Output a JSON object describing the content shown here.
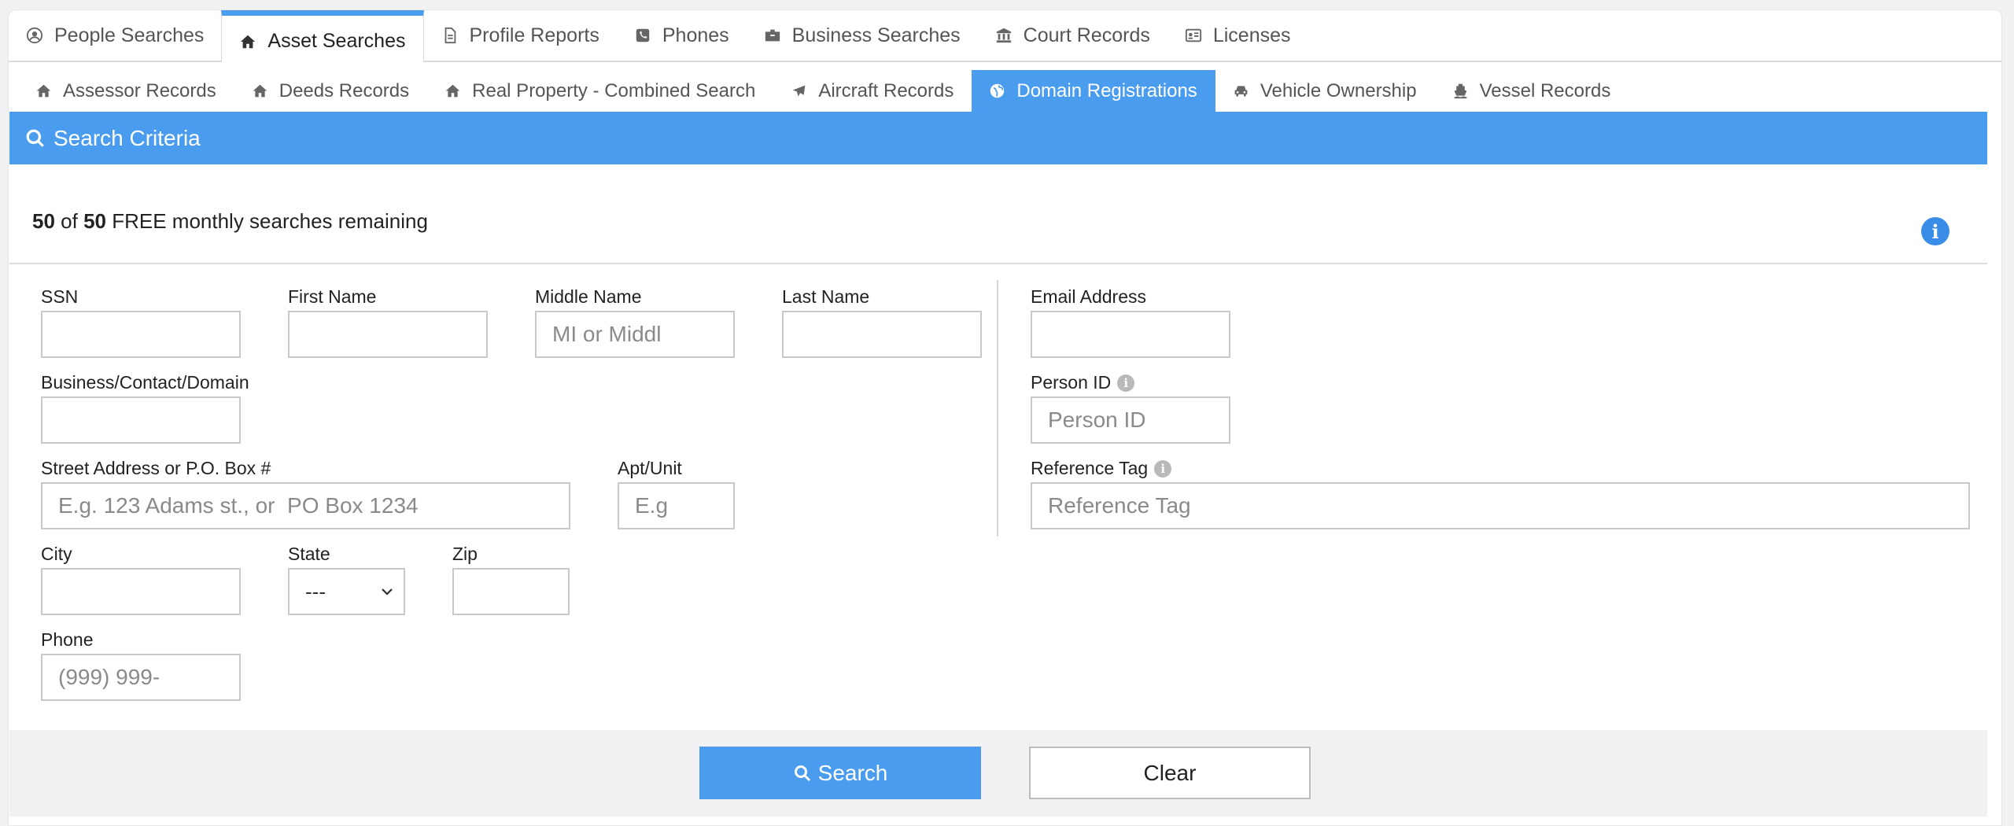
{
  "top_tabs": [
    {
      "label": "People Searches",
      "icon": "user-circle-icon"
    },
    {
      "label": "Asset Searches",
      "icon": "home-icon",
      "active": true
    },
    {
      "label": "Profile Reports",
      "icon": "document-icon"
    },
    {
      "label": "Phones",
      "icon": "phone-icon"
    },
    {
      "label": "Business Searches",
      "icon": "briefcase-icon"
    },
    {
      "label": "Court Records",
      "icon": "courthouse-icon"
    },
    {
      "label": "Licenses",
      "icon": "id-card-icon"
    }
  ],
  "sub_tabs": [
    {
      "label": "Assessor Records",
      "icon": "home-icon"
    },
    {
      "label": "Deeds Records",
      "icon": "home-icon"
    },
    {
      "label": "Real Property - Combined Search",
      "icon": "home-icon"
    },
    {
      "label": "Aircraft Records",
      "icon": "plane-icon"
    },
    {
      "label": "Domain Registrations",
      "icon": "globe-icon",
      "active": true
    },
    {
      "label": "Vehicle Ownership",
      "icon": "car-icon"
    },
    {
      "label": "Vessel Records",
      "icon": "ship-icon"
    }
  ],
  "panel": {
    "title": "Search Criteria"
  },
  "quota": {
    "used": "50",
    "of": "of",
    "total": "50",
    "text": "FREE monthly searches remaining"
  },
  "form": {
    "ssn": {
      "label": "SSN",
      "value": "",
      "placeholder": ""
    },
    "first_name": {
      "label": "First Name",
      "value": "",
      "placeholder": ""
    },
    "middle_name": {
      "label": "Middle Name",
      "value": "",
      "placeholder": "MI or Middl"
    },
    "last_name": {
      "label": "Last Name",
      "value": "",
      "placeholder": ""
    },
    "business": {
      "label": "Business/Contact/Domain",
      "value": "",
      "placeholder": ""
    },
    "street": {
      "label": "Street Address or P.O. Box #",
      "value": "",
      "placeholder": "E.g. 123 Adams st., or  PO Box 1234"
    },
    "apt": {
      "label": "Apt/Unit",
      "value": "",
      "placeholder": "E.g"
    },
    "city": {
      "label": "City",
      "value": "",
      "placeholder": ""
    },
    "state": {
      "label": "State",
      "selected": "---"
    },
    "zip": {
      "label": "Zip",
      "value": "",
      "placeholder": ""
    },
    "phone": {
      "label": "Phone",
      "value": "",
      "placeholder": "(999) 999-"
    },
    "email": {
      "label": "Email Address",
      "value": "",
      "placeholder": ""
    },
    "person_id": {
      "label": "Person ID",
      "value": "",
      "placeholder": "Person ID"
    },
    "reference_tag": {
      "label": "Reference Tag",
      "value": "",
      "placeholder": "Reference Tag"
    }
  },
  "buttons": {
    "search": "Search",
    "clear": "Clear"
  },
  "colors": {
    "accent": "#4a9cef",
    "info": "#3a8de6"
  }
}
